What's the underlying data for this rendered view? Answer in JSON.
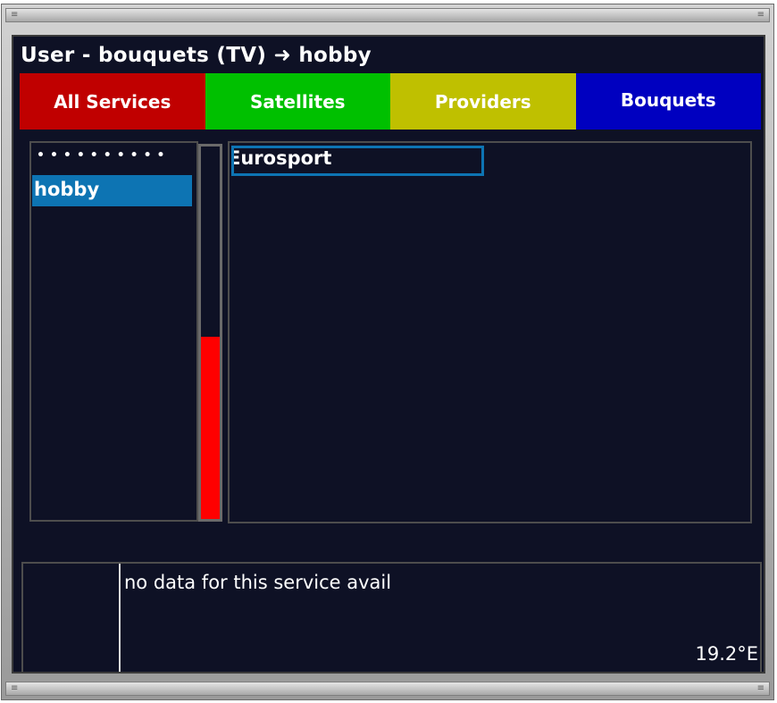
{
  "window": {
    "grip_left": "≡",
    "grip_right": "≡"
  },
  "header": {
    "title": "User - bouquets (TV) ➜ hobby"
  },
  "tabs": [
    {
      "label": "All Services",
      "color": "#c00000"
    },
    {
      "label": "Satellites",
      "color": "#00c000"
    },
    {
      "label": "Providers",
      "color": "#bfc000"
    },
    {
      "label": "Bouquets",
      "color": "#0000c0"
    }
  ],
  "bouquet_list": {
    "dots": "••••••••••",
    "items": [
      {
        "label": "hobby",
        "selected": true
      }
    ],
    "scroll_fraction": 0.49
  },
  "service_list": {
    "items": [
      {
        "label": "Eurosport",
        "selected": true
      }
    ]
  },
  "info": {
    "text": "no data for this service avail",
    "position": "19.2°E"
  },
  "colors": {
    "selection": "#0d74b3",
    "background": "#0e1125",
    "scroll_thumb": "#ff0000"
  }
}
